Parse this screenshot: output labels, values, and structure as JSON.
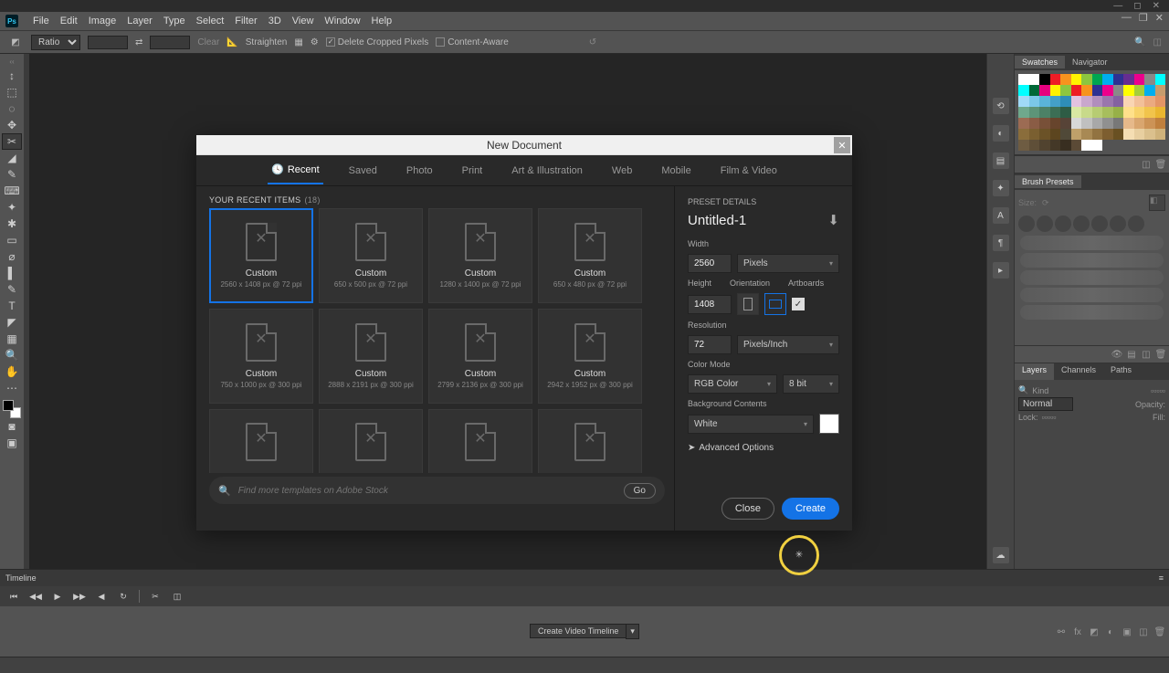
{
  "app": {
    "name": "Ps"
  },
  "menus": [
    "File",
    "Edit",
    "Image",
    "Layer",
    "Type",
    "Select",
    "Filter",
    "3D",
    "View",
    "Window",
    "Help"
  ],
  "options": {
    "ratio": "Ratio",
    "clear": "Clear",
    "straighten": "Straighten",
    "delete_cropped": "Delete Cropped Pixels",
    "content_aware": "Content-Aware"
  },
  "tools": [
    "↕",
    "⬚",
    "◌",
    "✥",
    "✂",
    "◢",
    "✎",
    "⌨",
    "✦",
    "✱",
    "▭",
    "⌀",
    "▌",
    "✎",
    "T",
    "◤",
    "▦",
    "🔍",
    "✋",
    "⋯"
  ],
  "panels": {
    "swatches_tab": "Swatches",
    "navigator_tab": "Navigator",
    "brush_tab": "Brush Presets",
    "brush_size_label": "Size:",
    "layers_tab": "Layers",
    "channels_tab": "Channels",
    "paths_tab": "Paths",
    "layers": {
      "kind": "Kind",
      "normal": "Normal",
      "opacity": "Opacity:",
      "lock": "Lock:",
      "fill": "Fill:"
    }
  },
  "swatch_colors": [
    [
      "#ffffff",
      "#ffffff",
      "#000000",
      "#ee1c25",
      "#f7931e",
      "#fff200",
      "#8cc63f",
      "#00a651",
      "#00aeef",
      "#2e3192",
      "#662d91",
      "#ec008c",
      "#898989",
      "#00ffff"
    ],
    [
      "#00ffff",
      "#006837",
      "#e6007e",
      "#fff200",
      "#8dc63f",
      "#ed1c24",
      "#f7931e",
      "#2e3192",
      "#ec008c",
      "#898989",
      "#ffff00",
      "#a6ce39",
      "#00aeef",
      "#c69c6d"
    ],
    [
      "#a0d9f6",
      "#7bc8e8",
      "#5ab4d8",
      "#44a0c8",
      "#2e8eb8",
      "#e2c2e0",
      "#c9a7cd",
      "#b18ebd",
      "#9a76ad",
      "#8462a0",
      "#f9d5b3",
      "#f2c099",
      "#ebaa80",
      "#e39566"
    ],
    [
      "#6fa88c",
      "#5d9478",
      "#4c8166",
      "#3c6e55",
      "#2e5c45",
      "#d9e8a3",
      "#c8da8a",
      "#b7cc73",
      "#a7be5d",
      "#97b048",
      "#ffe08a",
      "#f8d26a",
      "#f1c44c",
      "#eab630"
    ],
    [
      "#9c6b53",
      "#8a5c45",
      "#785038",
      "#67442c",
      "#574337",
      "#d8d8d8",
      "#c0c0c0",
      "#a8a8a8",
      "#909090",
      "#787878",
      "#e6b98a",
      "#d9a66f",
      "#cc9356",
      "#bf803e"
    ],
    [
      "#8a6d3b",
      "#7a5f30",
      "#6b5227",
      "#5c451f",
      "#504938",
      "#bfa06a",
      "#a88954",
      "#927341",
      "#7d5e30",
      "#695022",
      "#f5deb3",
      "#e8cfa0",
      "#dbc08d",
      "#cfb27b"
    ],
    [
      "#6e5c42",
      "#5f4f38",
      "#51432f",
      "#443827",
      "#382e20",
      "#5b4a36",
      "#ffffff",
      "#ffffff",
      "#535353",
      "#535353",
      "#535353",
      "#535353",
      "#535353",
      "#535353"
    ]
  ],
  "timeline": {
    "label": "Timeline",
    "create_btn": "Create Video Timeline"
  },
  "dialog": {
    "title": "New Document",
    "tabs": [
      "Recent",
      "Saved",
      "Photo",
      "Print",
      "Art & Illustration",
      "Web",
      "Mobile",
      "Film & Video"
    ],
    "active_tab": 0,
    "recent_label": "YOUR RECENT ITEMS",
    "recent_count": "(18)",
    "presets": [
      {
        "name": "Custom",
        "dim": "2560 x 1408 px @ 72 ppi",
        "sel": true
      },
      {
        "name": "Custom",
        "dim": "650 x 500 px @ 72 ppi"
      },
      {
        "name": "Custom",
        "dim": "1280 x 1400 px @ 72 ppi"
      },
      {
        "name": "Custom",
        "dim": "650 x 480 px @ 72 ppi"
      },
      {
        "name": "Custom",
        "dim": "750 x 1000 px @ 300 ppi"
      },
      {
        "name": "Custom",
        "dim": "2888 x 2191 px @ 300 ppi"
      },
      {
        "name": "Custom",
        "dim": "2799 x 2136 px @ 300 ppi"
      },
      {
        "name": "Custom",
        "dim": "2942 x 1952 px @ 300 ppi"
      }
    ],
    "search_placeholder": "Find more templates on Adobe Stock",
    "go": "Go",
    "details": {
      "header": "PRESET DETAILS",
      "name": "Untitled-1",
      "width_label": "Width",
      "width": "2560",
      "width_unit": "Pixels",
      "height_label": "Height",
      "height": "1408",
      "orientation_label": "Orientation",
      "artboards_label": "Artboards",
      "resolution_label": "Resolution",
      "resolution": "72",
      "res_unit": "Pixels/Inch",
      "colormode_label": "Color Mode",
      "colormode": "RGB Color",
      "bitdepth": "8 bit",
      "bg_label": "Background Contents",
      "bg": "White",
      "advanced": "Advanced Options",
      "close": "Close",
      "create": "Create"
    }
  }
}
